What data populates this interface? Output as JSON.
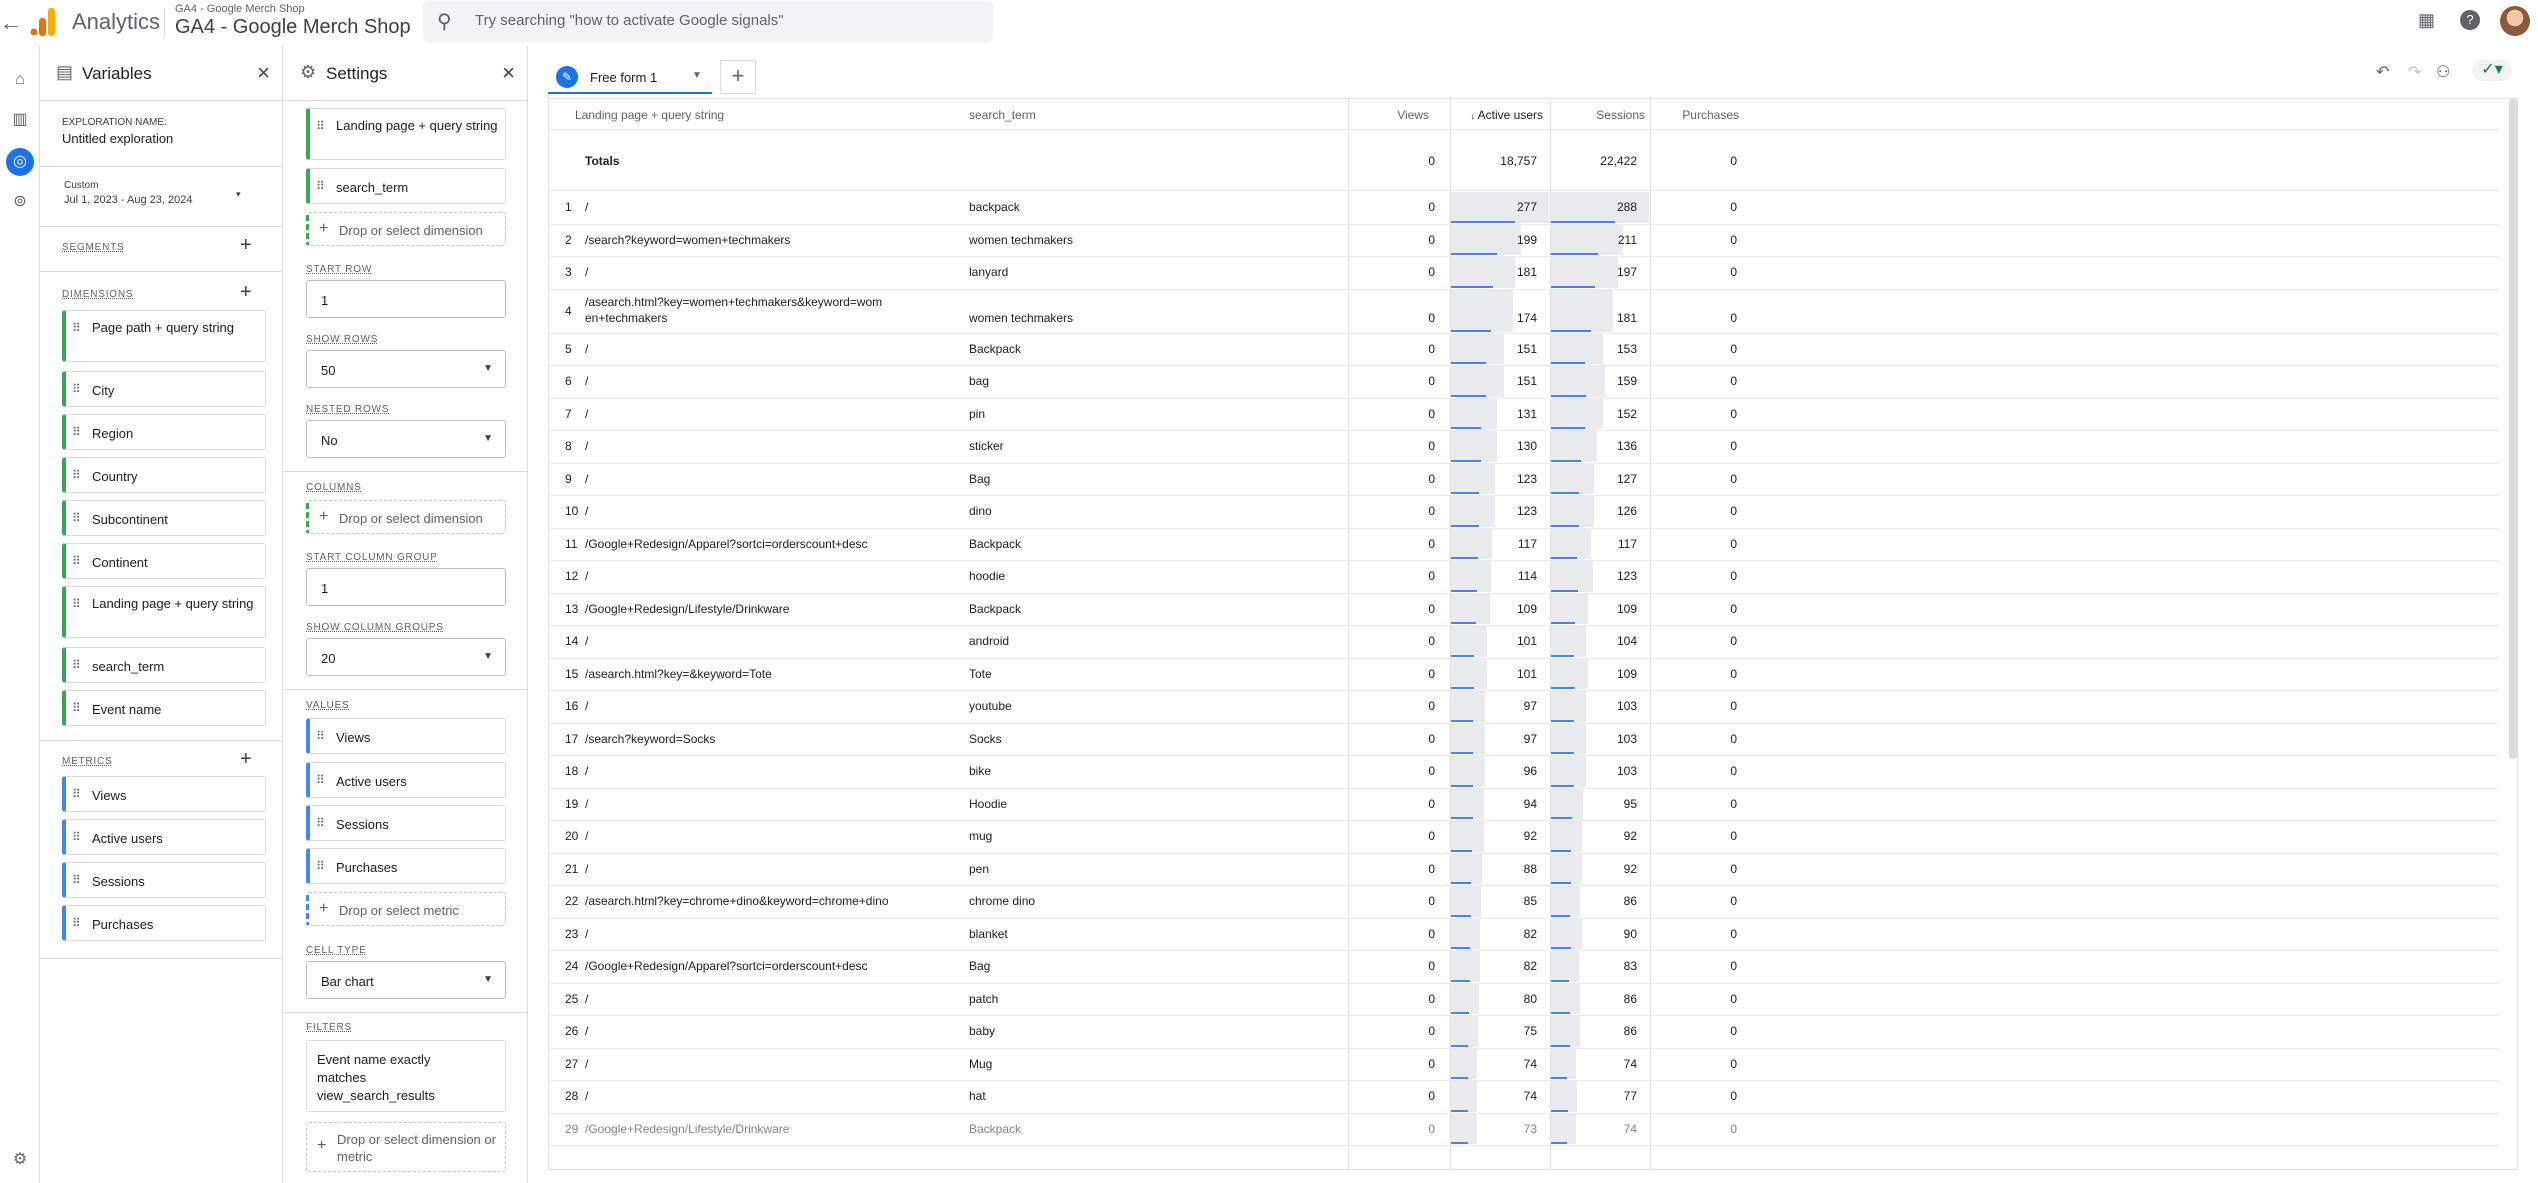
{
  "header": {
    "app_name": "Analytics",
    "account_small": "GA4 - Google Merch Shop",
    "property": "GA4 - Google Merch Shop",
    "search_placeholder": "Try searching \"how to activate Google signals\""
  },
  "colors": {
    "accent": "#1a73e8",
    "dimension": "#34a853",
    "metric": "#4285f4"
  },
  "variables": {
    "title": "Variables",
    "exploration_label": "EXPLORATION NAME:",
    "exploration_name": "Untitled exploration",
    "date_label": "Custom",
    "date_range": "Jul 1, 2023 - Aug 23, 2024",
    "segments_label": "SEGMENTS",
    "dimensions_label": "DIMENSIONS",
    "dimensions": [
      "Page path + query string",
      "City",
      "Region",
      "Country",
      "Subcontinent",
      "Continent",
      "Landing page + query string",
      "search_term",
      "Event name"
    ],
    "metrics_label": "METRICS",
    "metrics": [
      "Views",
      "Active users",
      "Sessions",
      "Purchases"
    ]
  },
  "settings": {
    "title": "Settings",
    "rows_dims": [
      "Landing page + query string",
      "search_term"
    ],
    "drop_dimension": "Drop or select dimension",
    "start_row_label": "START ROW",
    "start_row": "1",
    "show_rows_label": "SHOW ROWS",
    "show_rows": "50",
    "nested_rows_label": "NESTED ROWS",
    "nested_rows": "No",
    "columns_label": "COLUMNS",
    "start_col_group_label": "START COLUMN GROUP",
    "start_col_group": "1",
    "show_col_groups_label": "SHOW COLUMN GROUPS",
    "show_col_groups": "20",
    "values_label": "VALUES",
    "values": [
      "Views",
      "Active users",
      "Sessions",
      "Purchases"
    ],
    "drop_metric": "Drop or select metric",
    "cell_type_label": "CELL TYPE",
    "cell_type": "Bar chart",
    "filters_label": "FILTERS",
    "filter_text": "Event name exactly matches view_search_results",
    "drop_dim_or_metric": "Drop or select dimension or metric"
  },
  "tab": {
    "name": "Free form 1"
  },
  "table": {
    "headers": {
      "landing": "Landing page + query string",
      "term": "search_term",
      "views": "Views",
      "active": "Active users",
      "sessions": "Sessions",
      "purchases": "Purchases",
      "sort_arrow": "↓"
    },
    "totals": {
      "label": "Totals",
      "views": "0",
      "active": "18,757",
      "sessions": "22,422",
      "purchases": "0"
    },
    "max_active": 277,
    "max_sessions": 288,
    "rows": [
      {
        "n": "1",
        "page": "/",
        "term": "backpack",
        "views": "0",
        "active": 277,
        "sessions": 288,
        "purchases": "0"
      },
      {
        "n": "2",
        "page": "/search?keyword=women+techmakers",
        "term": "women techmakers",
        "views": "0",
        "active": 199,
        "sessions": 211,
        "purchases": "0"
      },
      {
        "n": "3",
        "page": "/",
        "term": "lanyard",
        "views": "0",
        "active": 181,
        "sessions": 197,
        "purchases": "0"
      },
      {
        "n": "4",
        "page": "/asearch.html?key=women+techmakers&keyword=wom",
        "page2": "en+techmakers",
        "term": "women techmakers",
        "views": "0",
        "active": 174,
        "sessions": 181,
        "purchases": "0"
      },
      {
        "n": "5",
        "page": "/",
        "term": "Backpack",
        "views": "0",
        "active": 151,
        "sessions": 153,
        "purchases": "0"
      },
      {
        "n": "6",
        "page": "/",
        "term": "bag",
        "views": "0",
        "active": 151,
        "sessions": 159,
        "purchases": "0"
      },
      {
        "n": "7",
        "page": "/",
        "term": "pin",
        "views": "0",
        "active": 131,
        "sessions": 152,
        "purchases": "0"
      },
      {
        "n": "8",
        "page": "/",
        "term": "sticker",
        "views": "0",
        "active": 130,
        "sessions": 136,
        "purchases": "0"
      },
      {
        "n": "9",
        "page": "/",
        "term": "Bag",
        "views": "0",
        "active": 123,
        "sessions": 127,
        "purchases": "0"
      },
      {
        "n": "10",
        "page": "/",
        "term": "dino",
        "views": "0",
        "active": 123,
        "sessions": 126,
        "purchases": "0"
      },
      {
        "n": "11",
        "page": "/Google+Redesign/Apparel?sortci=orderscount+desc",
        "term": "Backpack",
        "views": "0",
        "active": 117,
        "sessions": 117,
        "purchases": "0"
      },
      {
        "n": "12",
        "page": "/",
        "term": "hoodie",
        "views": "0",
        "active": 114,
        "sessions": 123,
        "purchases": "0"
      },
      {
        "n": "13",
        "page": "/Google+Redesign/Lifestyle/Drinkware",
        "term": "Backpack",
        "views": "0",
        "active": 109,
        "sessions": 109,
        "purchases": "0"
      },
      {
        "n": "14",
        "page": "/",
        "term": "android",
        "views": "0",
        "active": 101,
        "sessions": 104,
        "purchases": "0"
      },
      {
        "n": "15",
        "page": "/asearch.html?key=&keyword=Tote",
        "term": "Tote",
        "views": "0",
        "active": 101,
        "sessions": 109,
        "purchases": "0"
      },
      {
        "n": "16",
        "page": "/",
        "term": "youtube",
        "views": "0",
        "active": 97,
        "sessions": 103,
        "purchases": "0"
      },
      {
        "n": "17",
        "page": "/search?keyword=Socks",
        "term": "Socks",
        "views": "0",
        "active": 97,
        "sessions": 103,
        "purchases": "0"
      },
      {
        "n": "18",
        "page": "/",
        "term": "bike",
        "views": "0",
        "active": 96,
        "sessions": 103,
        "purchases": "0"
      },
      {
        "n": "19",
        "page": "/",
        "term": "Hoodie",
        "views": "0",
        "active": 94,
        "sessions": 95,
        "purchases": "0"
      },
      {
        "n": "20",
        "page": "/",
        "term": "mug",
        "views": "0",
        "active": 92,
        "sessions": 92,
        "purchases": "0"
      },
      {
        "n": "21",
        "page": "/",
        "term": "pen",
        "views": "0",
        "active": 88,
        "sessions": 92,
        "purchases": "0"
      },
      {
        "n": "22",
        "page": "/asearch.html?key=chrome+dino&keyword=chrome+dino",
        "term": "chrome dino",
        "views": "0",
        "active": 85,
        "sessions": 86,
        "purchases": "0"
      },
      {
        "n": "23",
        "page": "/",
        "term": "blanket",
        "views": "0",
        "active": 82,
        "sessions": 90,
        "purchases": "0"
      },
      {
        "n": "24",
        "page": "/Google+Redesign/Apparel?sortci=orderscount+desc",
        "term": "Bag",
        "views": "0",
        "active": 82,
        "sessions": 83,
        "purchases": "0"
      },
      {
        "n": "25",
        "page": "/",
        "term": "patch",
        "views": "0",
        "active": 80,
        "sessions": 86,
        "purchases": "0"
      },
      {
        "n": "26",
        "page": "/",
        "term": "baby",
        "views": "0",
        "active": 75,
        "sessions": 86,
        "purchases": "0"
      },
      {
        "n": "27",
        "page": "/",
        "term": "Mug",
        "views": "0",
        "active": 74,
        "sessions": 74,
        "purchases": "0"
      },
      {
        "n": "28",
        "page": "/",
        "term": "hat",
        "views": "0",
        "active": 74,
        "sessions": 77,
        "purchases": "0"
      },
      {
        "n": "29",
        "page": "/Google+Redesign/Lifestyle/Drinkware",
        "term": "Backpack",
        "views": "0",
        "active": 73,
        "sessions": 74,
        "purchases": "0"
      }
    ]
  }
}
